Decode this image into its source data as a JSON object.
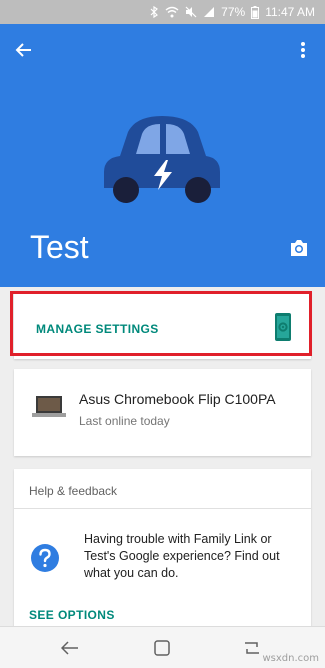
{
  "status_bar": {
    "battery": "77%",
    "time": "11:47 AM"
  },
  "hero": {
    "name": "Test",
    "background_color": "#2f7de1",
    "icons": [
      "back-arrow-icon",
      "more-vert-icon",
      "car-bolt-icon",
      "camera-icon"
    ]
  },
  "manage_settings": {
    "label": "MANAGE SETTINGS",
    "icon": "phone-gear-icon",
    "highlight_color": "#e0202a"
  },
  "device": {
    "name": "Asus Chromebook Flip C100PA",
    "status": "Last online today",
    "icon": "laptop-icon"
  },
  "help": {
    "title": "Help & feedback",
    "body": "Having trouble with Family Link or Test's Google experience? Find out what you can do.",
    "action": "SEE OPTIONS",
    "icon": "help-circle-icon"
  },
  "nav_bar": {
    "icons": [
      "back-icon",
      "home-icon",
      "recents-icon"
    ]
  },
  "watermark": "wsxdn.com",
  "accent_color": "#00897b"
}
